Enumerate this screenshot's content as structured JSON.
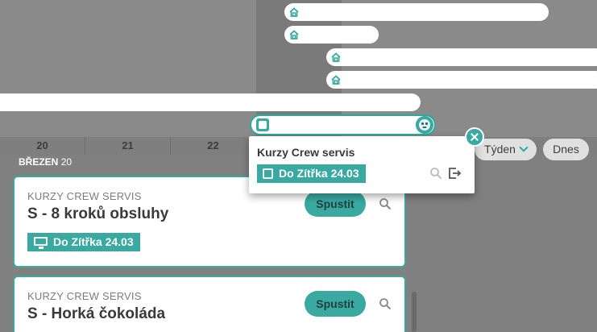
{
  "gantt": {
    "bars": [
      {
        "icon": "home-icon"
      },
      {
        "icon": "home-icon"
      },
      {
        "icon": "home-icon"
      },
      {
        "icon": "home-icon"
      }
    ],
    "dates": [
      "20",
      "21",
      "22"
    ],
    "month_label": "BŘEZEN",
    "month_day": "20"
  },
  "view": {
    "week_label": "Týden",
    "today_label": "Dnes"
  },
  "popup": {
    "title": "Kurzy Crew servis",
    "deadline": "Do Zítřka 24.03"
  },
  "cards": [
    {
      "org": "KURZY CREW SERVIS",
      "title": "S - 8 kroků obsluhy",
      "deadline": "Do Zítřka 24.03",
      "run_label": "Spustit"
    },
    {
      "org": "KURZY CREW SERVIS",
      "title": "S - Horká čokoláda",
      "run_label": "Spustit"
    }
  ],
  "colors": {
    "accent": "#3aa9a2"
  }
}
